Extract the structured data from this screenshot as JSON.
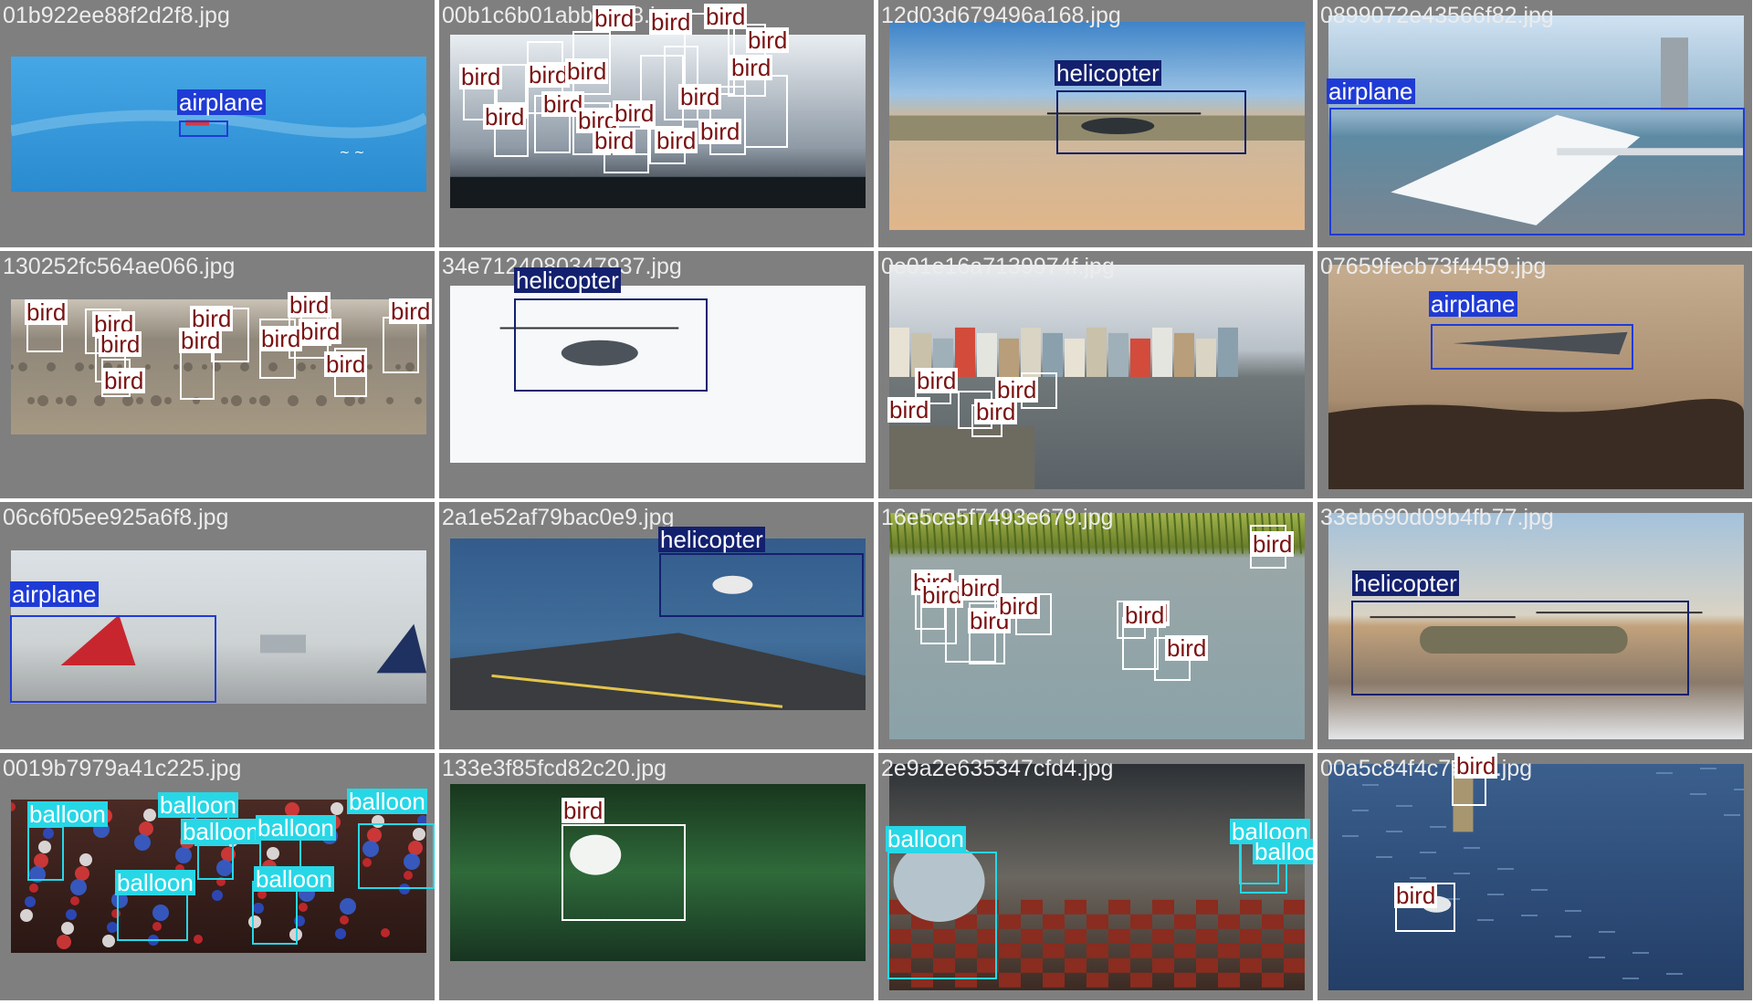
{
  "grid": {
    "cells": [
      {
        "filename": "01b922ee88f2d2f8.jpg",
        "scene": "sky-blue",
        "detections": [
          {
            "label": "airplane",
            "class": "airplane"
          }
        ]
      },
      {
        "filename": "00b1c6b01abb2be8.jpg",
        "scene": "cloudy-sky-birds",
        "detections": [
          {
            "label": "bird",
            "class": "bird"
          },
          {
            "label": "bird",
            "class": "bird"
          },
          {
            "label": "bird",
            "class": "bird"
          },
          {
            "label": "bird",
            "class": "bird"
          },
          {
            "label": "bird",
            "class": "bird"
          },
          {
            "label": "bird",
            "class": "bird"
          },
          {
            "label": "bird",
            "class": "bird"
          },
          {
            "label": "bird",
            "class": "bird"
          },
          {
            "label": "bird",
            "class": "bird"
          },
          {
            "label": "bird",
            "class": "bird"
          },
          {
            "label": "bird",
            "class": "bird"
          },
          {
            "label": "bird",
            "class": "bird"
          },
          {
            "label": "bird",
            "class": "bird"
          },
          {
            "label": "bird",
            "class": "bird"
          },
          {
            "label": "bird",
            "class": "bird"
          },
          {
            "label": "bird",
            "class": "bird"
          }
        ]
      },
      {
        "filename": "12d03d679496a168.jpg",
        "scene": "beach-helicopter",
        "detections": [
          {
            "label": "helicopter",
            "class": "helicopter"
          }
        ]
      },
      {
        "filename": "0899072e43566f82.jpg",
        "scene": "airplane-runway",
        "detections": [
          {
            "label": "airplane",
            "class": "airplane"
          }
        ]
      },
      {
        "filename": "130252fc564ae066.jpg",
        "scene": "pelicans-beach",
        "detections": [
          {
            "label": "bird",
            "class": "bird"
          },
          {
            "label": "bird",
            "class": "bird"
          },
          {
            "label": "bird",
            "class": "bird"
          },
          {
            "label": "bird",
            "class": "bird"
          },
          {
            "label": "bird",
            "class": "bird"
          },
          {
            "label": "bird",
            "class": "bird"
          },
          {
            "label": "bird",
            "class": "bird"
          },
          {
            "label": "bird",
            "class": "bird"
          },
          {
            "label": "bird",
            "class": "bird"
          },
          {
            "label": "bird",
            "class": "bird"
          },
          {
            "label": "bird",
            "class": "bird"
          }
        ]
      },
      {
        "filename": "34e7124080347937.jpg",
        "scene": "white-helicopter",
        "detections": [
          {
            "label": "helicopter",
            "class": "helicopter"
          }
        ]
      },
      {
        "filename": "0e01e16a7139974f.jpg",
        "scene": "harbor-town",
        "detections": [
          {
            "label": "bird",
            "class": "bird"
          },
          {
            "label": "bird",
            "class": "bird"
          },
          {
            "label": "bird",
            "class": "bird"
          },
          {
            "label": "bird",
            "class": "bird"
          }
        ]
      },
      {
        "filename": "07659fecb73f4459.jpg",
        "scene": "sepia-jet",
        "detections": [
          {
            "label": "airplane",
            "class": "airplane"
          }
        ]
      },
      {
        "filename": "06c6f05ee925a6f8.jpg",
        "scene": "airport-tails",
        "detections": [
          {
            "label": "airplane",
            "class": "airplane"
          }
        ]
      },
      {
        "filename": "2a1e52af79bac0e9.jpg",
        "scene": "carrier-deck",
        "detections": [
          {
            "label": "helicopter",
            "class": "helicopter"
          }
        ]
      },
      {
        "filename": "16e5ce5f7493e679.jpg",
        "scene": "lake-ducks",
        "detections": [
          {
            "label": "bird",
            "class": "bird"
          },
          {
            "label": "bird",
            "class": "bird"
          },
          {
            "label": "bird",
            "class": "bird"
          },
          {
            "label": "bird",
            "class": "bird"
          },
          {
            "label": "bird",
            "class": "bird"
          },
          {
            "label": "bird",
            "class": "bird"
          },
          {
            "label": "bird",
            "class": "bird"
          },
          {
            "label": "bird",
            "class": "bird"
          },
          {
            "label": "bird",
            "class": "bird"
          }
        ]
      },
      {
        "filename": "33eb690d09b4fb77.jpg",
        "scene": "chinook-desert",
        "detections": [
          {
            "label": "helicopter",
            "class": "helicopter"
          }
        ]
      },
      {
        "filename": "0019b7979a41c225.jpg",
        "scene": "party-balloons",
        "detections": [
          {
            "label": "balloon",
            "class": "balloon"
          },
          {
            "label": "balloon",
            "class": "balloon"
          },
          {
            "label": "balloon",
            "class": "balloon"
          },
          {
            "label": "balloon",
            "class": "balloon"
          },
          {
            "label": "balloon",
            "class": "balloon"
          },
          {
            "label": "balloon",
            "class": "balloon"
          },
          {
            "label": "balloon",
            "class": "balloon"
          }
        ]
      },
      {
        "filename": "133e3f85fcd82c20.jpg",
        "scene": "egret-green",
        "detections": [
          {
            "label": "bird",
            "class": "bird"
          }
        ]
      },
      {
        "filename": "2e9a2e635347cfd4.jpg",
        "scene": "virtual-room",
        "detections": [
          {
            "label": "balloon",
            "class": "balloon"
          },
          {
            "label": "balloon",
            "class": "balloon"
          },
          {
            "label": "balloon",
            "class": "balloon"
          }
        ]
      },
      {
        "filename": "00a5c84f4c7af3d.jpg",
        "scene": "seagull-water",
        "detections": [
          {
            "label": "bird",
            "class": "bird"
          },
          {
            "label": "bird",
            "class": "bird"
          }
        ]
      }
    ]
  },
  "colors": {
    "cell_background": "#7f7f7f",
    "filename_text": "#ececec",
    "airplane": "#1f3bd6",
    "helicopter": "#13206e",
    "bird": "#ffffff",
    "bird_text": "#7a1212",
    "balloon": "#27d7e6"
  }
}
